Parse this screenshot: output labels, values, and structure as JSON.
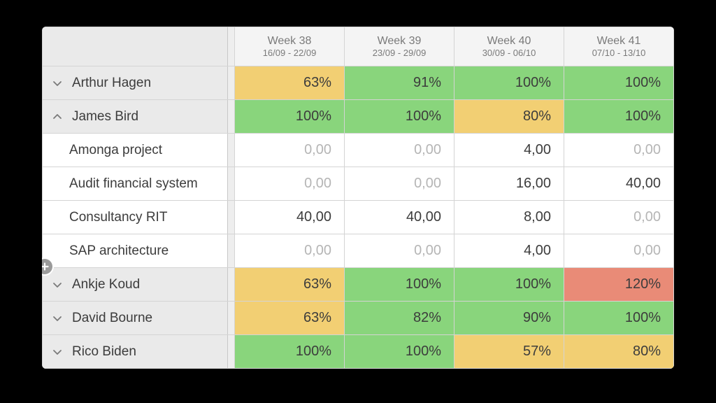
{
  "columns": [
    {
      "title": "Week 38",
      "range": "16/09 - 22/09"
    },
    {
      "title": "Week 39",
      "range": "23/09 - 29/09"
    },
    {
      "title": "Week 40",
      "range": "30/09 - 06/10"
    },
    {
      "title": "Week 41",
      "range": "07/10 - 13/10"
    }
  ],
  "colors": {
    "green": "#89d57c",
    "amber": "#f2cf73",
    "red": "#e98b77"
  },
  "rows": [
    {
      "kind": "person",
      "expanded": false,
      "name": "Arthur Hagen",
      "cells": [
        {
          "text": "63%",
          "bg": "amber"
        },
        {
          "text": "91%",
          "bg": "green"
        },
        {
          "text": "100%",
          "bg": "green"
        },
        {
          "text": "100%",
          "bg": "green"
        }
      ]
    },
    {
      "kind": "person",
      "expanded": true,
      "name": "James Bird",
      "cells": [
        {
          "text": "100%",
          "bg": "green"
        },
        {
          "text": "100%",
          "bg": "green"
        },
        {
          "text": "80%",
          "bg": "amber"
        },
        {
          "text": "100%",
          "bg": "green"
        }
      ]
    },
    {
      "kind": "project",
      "name": "Amonga project",
      "cells": [
        {
          "text": "0,00",
          "muted": true
        },
        {
          "text": "0,00",
          "muted": true
        },
        {
          "text": "4,00"
        },
        {
          "text": "0,00",
          "muted": true
        }
      ]
    },
    {
      "kind": "project",
      "name": "Audit financial system",
      "cells": [
        {
          "text": "0,00",
          "muted": true
        },
        {
          "text": "0,00",
          "muted": true
        },
        {
          "text": "16,00"
        },
        {
          "text": "40,00"
        }
      ]
    },
    {
      "kind": "project",
      "name": "Consultancy RIT",
      "cells": [
        {
          "text": "40,00"
        },
        {
          "text": "40,00"
        },
        {
          "text": "8,00"
        },
        {
          "text": "0,00",
          "muted": true
        }
      ]
    },
    {
      "kind": "project",
      "name": "SAP architecture",
      "showAdd": true,
      "cells": [
        {
          "text": "0,00",
          "muted": true
        },
        {
          "text": "0,00",
          "muted": true
        },
        {
          "text": "4,00"
        },
        {
          "text": "0,00",
          "muted": true
        }
      ]
    },
    {
      "kind": "person",
      "expanded": false,
      "name": "Ankje Koud",
      "cells": [
        {
          "text": "63%",
          "bg": "amber"
        },
        {
          "text": "100%",
          "bg": "green"
        },
        {
          "text": "100%",
          "bg": "green"
        },
        {
          "text": "120%",
          "bg": "red"
        }
      ]
    },
    {
      "kind": "person",
      "expanded": false,
      "name": "David Bourne",
      "cells": [
        {
          "text": "63%",
          "bg": "amber"
        },
        {
          "text": "82%",
          "bg": "green"
        },
        {
          "text": "90%",
          "bg": "green"
        },
        {
          "text": "100%",
          "bg": "green"
        }
      ]
    },
    {
      "kind": "person",
      "expanded": false,
      "name": "Rico Biden",
      "cells": [
        {
          "text": "100%",
          "bg": "green"
        },
        {
          "text": "100%",
          "bg": "green"
        },
        {
          "text": "57%",
          "bg": "amber"
        },
        {
          "text": "80%",
          "bg": "amber"
        }
      ]
    }
  ]
}
